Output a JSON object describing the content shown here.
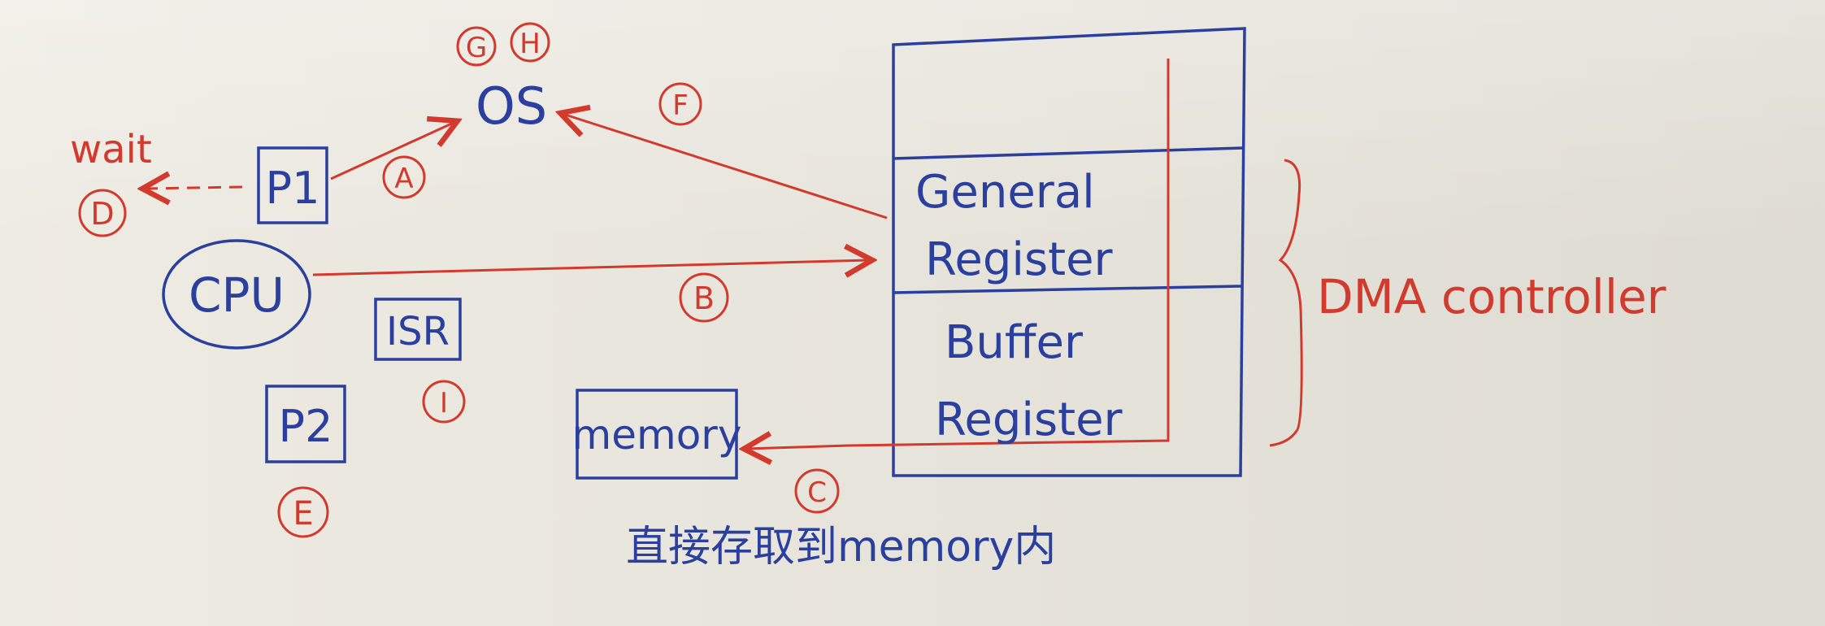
{
  "labels": {
    "os": "OS",
    "circle_g": "G",
    "circle_h": "H",
    "circle_f": "F",
    "wait": "wait",
    "circle_d": "D",
    "p1": "P1",
    "circle_a": "A",
    "cpu": "CPU",
    "circle_b": "B",
    "isr": "ISR",
    "circle_i": "I",
    "p2": "P2",
    "circle_e": "E",
    "memory": "memory",
    "circle_c": "C",
    "caption": "直接存取到memory内",
    "general_register_line1": "General",
    "general_register_line2": "Register",
    "buffer_register_line1": "Buffer",
    "buffer_register_line2": "Register",
    "dma_controller": "DMA controller"
  },
  "colors": {
    "blue_ink": "#2b3f9e",
    "red_ink": "#d23a2e",
    "paper": "#e9e6dd"
  }
}
